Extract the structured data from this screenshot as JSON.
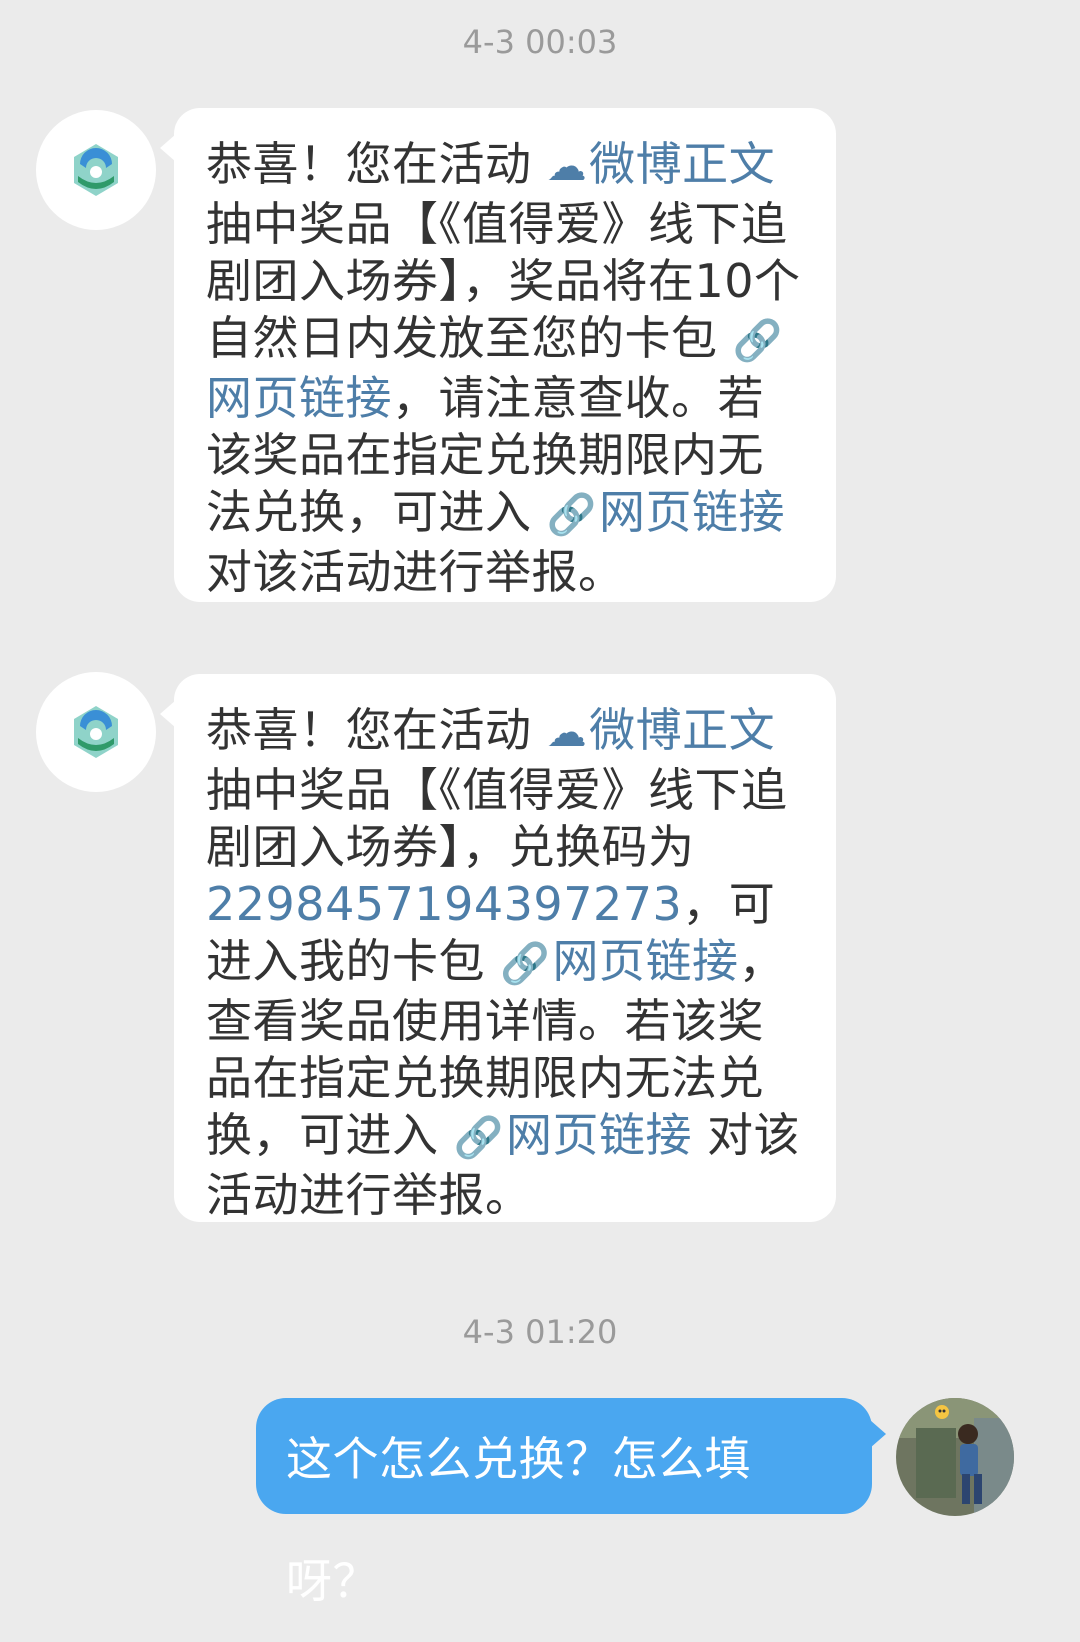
{
  "chat": {
    "timestamp_1": "4-3 00:03",
    "timestamp_2": "4-3 01:20",
    "message_1": {
      "part1": "恭喜！您在活动 ",
      "link_weibo": "微博正文",
      "part2": "抽中奖品【《值得爱》线下追剧团入场券】，奖品将在10个自然日内发放至您的卡包",
      "link_web_1": "网页链接",
      "part3": "，请注意查收。若该奖品在指定兑换期限内无法兑换，可进入 ",
      "link_web_2": "网页链接",
      "part4": "对该活动进行举报。"
    },
    "message_2": {
      "part1": "恭喜！您在活动 ",
      "link_weibo": "微博正文",
      "part2": "抽中奖品【《值得爱》线下追剧团入场券】，兑换码为",
      "code": "2298457194397273",
      "part3": "，可进入我的卡包 ",
      "link_web_1": "网页链接",
      "part4": "，查看奖品使用详情。若该奖品在指定兑换期限内无法兑换，可进入 ",
      "link_web_2": "网页链接",
      "part5": " 对该活动进行举报。"
    },
    "reply": "这个怎么兑换？怎么填呀？"
  },
  "icons": {
    "weibo_link": "cloud-icon",
    "web_link": "link-icon",
    "bot_avatar": "weibo-lottery-logo",
    "user_avatar": "user-photo"
  },
  "colors": {
    "background": "#ebebeb",
    "bubble_in": "#ffffff",
    "bubble_out": "#4aa7f0",
    "link": "#4e7ea8",
    "text": "#333333",
    "timestamp": "#9a9a9a"
  }
}
